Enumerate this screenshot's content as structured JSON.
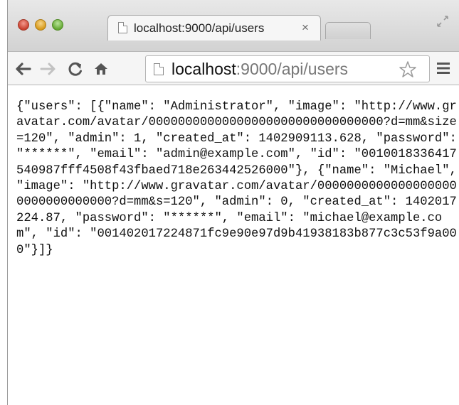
{
  "tab": {
    "title": "localhost:9000/api/users",
    "close": "×"
  },
  "omnibox": {
    "host": "localhost",
    "rest": ":9000/api/users"
  },
  "page": {
    "json_text": "{\"users\": [{\"name\": \"Administrator\", \"image\": \"http://www.gravatar.com/avatar/00000000000000000000000000000000?d=mm&size=120\", \"admin\": 1, \"created_at\": 1402909113.628, \"password\": \"******\", \"email\": \"admin@example.com\", \"id\": \"001001833641754098 7fff4508f43fbaed718e263442526000\"}, {\"name\": \"Michael\", \"image\": \"http://www.gravatar.com/avatar/00000000000000000000000000000000?d=mm&s=120\", \"admin\": 0, \"created_at\": 1402017224.87, \"password\": \"******\", \"email\": \"michael@example.com\", \"id\": \"001402017224871fc9e90e97d9b41938183b877c3c53f9a000\"}]}"
  },
  "icons": {
    "back": "back-arrow-icon",
    "forward": "forward-arrow-icon",
    "reload": "reload-icon",
    "home": "home-icon",
    "page": "page-icon",
    "star": "bookmark-star-icon",
    "menu": "hamburger-menu-icon",
    "fullscreen": "fullscreen-icon"
  }
}
